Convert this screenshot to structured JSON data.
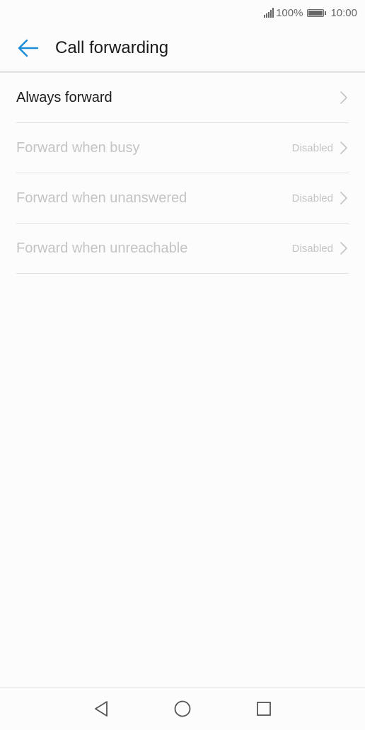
{
  "status_bar": {
    "battery_percent": "100%",
    "time": "10:00",
    "icons": [
      "signal-icon",
      "battery-icon"
    ]
  },
  "header": {
    "title": "Call forwarding",
    "back_icon": "arrow-left-icon"
  },
  "colors": {
    "accent": "#1a8cd8",
    "text_primary": "#1a1a1a",
    "text_disabled": "#c4c4c4",
    "background": "#fcfcfc"
  },
  "items": [
    {
      "label": "Always forward",
      "status": "",
      "enabled": true
    },
    {
      "label": "Forward when busy",
      "status": "Disabled",
      "enabled": false
    },
    {
      "label": "Forward when unanswered",
      "status": "Disabled",
      "enabled": false
    },
    {
      "label": "Forward when unreachable",
      "status": "Disabled",
      "enabled": false
    }
  ],
  "nav_bar": {
    "icons": [
      "back-triangle-icon",
      "home-circle-icon",
      "recents-square-icon"
    ]
  }
}
